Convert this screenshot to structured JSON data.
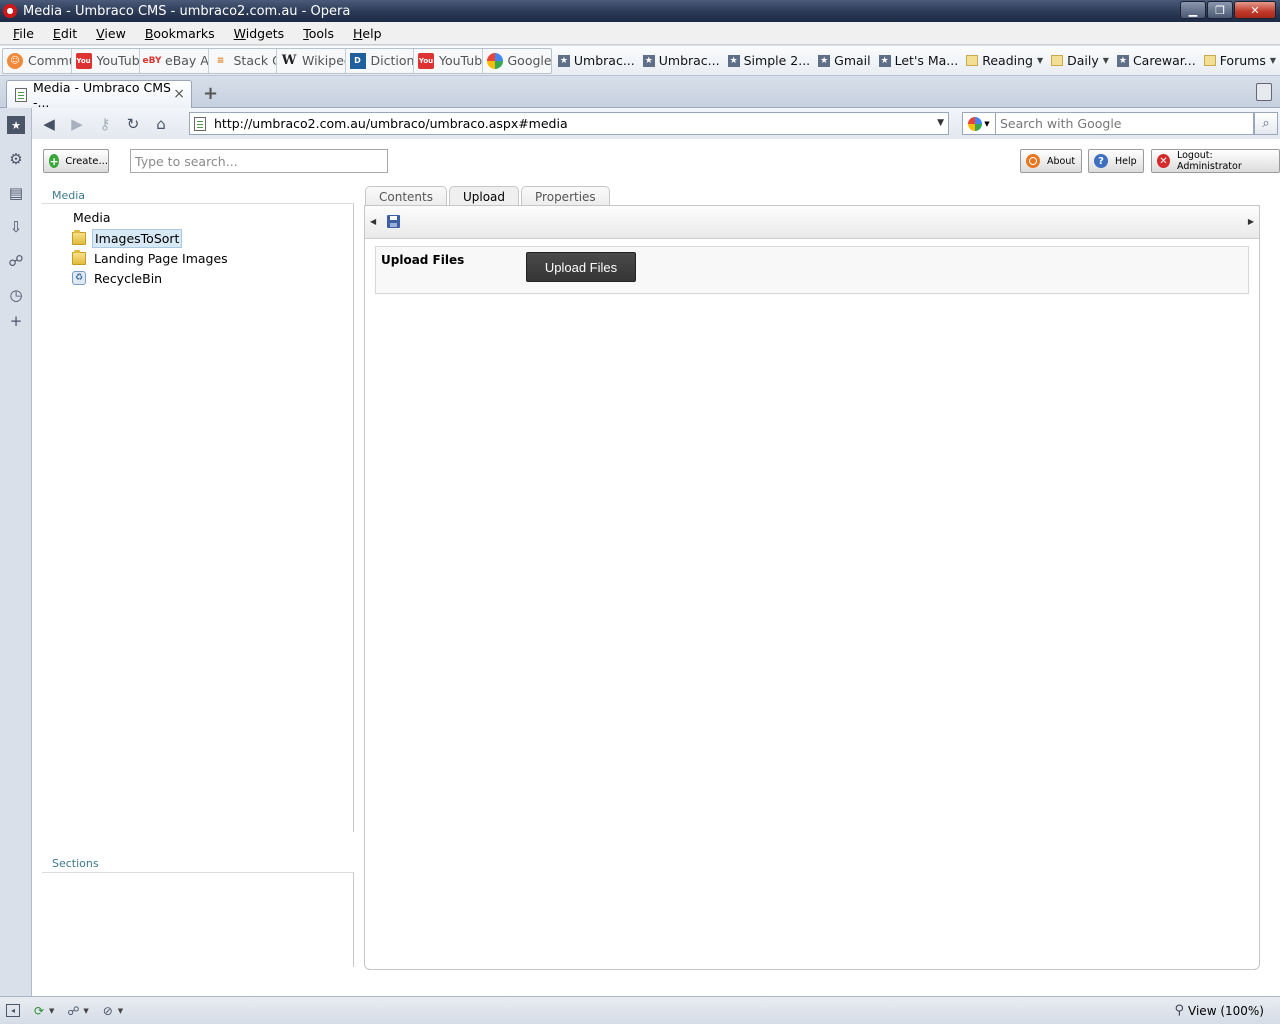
{
  "window": {
    "title": "Media - Umbraco CMS - umbraco2.com.au - Opera"
  },
  "menu": [
    {
      "label": "File",
      "ul": "F",
      "rest": "ile"
    },
    {
      "label": "Edit",
      "ul": "E",
      "rest": "dit"
    },
    {
      "label": "View",
      "ul": "V",
      "rest": "iew"
    },
    {
      "label": "Bookmarks",
      "ul": "B",
      "rest": "ookmarks"
    },
    {
      "label": "Widgets",
      "ul": "W",
      "rest": "idgets"
    },
    {
      "label": "Tools",
      "ul": "T",
      "rest": "ools"
    },
    {
      "label": "Help",
      "ul": "H",
      "rest": "elp"
    }
  ],
  "speed_dial": [
    {
      "label": "Commun",
      "icon": "community-icon"
    },
    {
      "label": "YouTube",
      "icon": "youtube-icon"
    },
    {
      "label": "eBay Aust",
      "icon": "ebay-icon"
    },
    {
      "label": "Stack Ove",
      "icon": "stackoverflow-icon"
    },
    {
      "label": "Wikipedia",
      "icon": "wikipedia-icon"
    },
    {
      "label": "Dictionary",
      "icon": "dictionary-icon"
    },
    {
      "label": "YouTube",
      "icon": "youtube-icon"
    },
    {
      "label": "Google",
      "icon": "google-icon"
    }
  ],
  "bookmarks": [
    {
      "label": "Umbrac...",
      "type": "star"
    },
    {
      "label": "Umbrac...",
      "type": "star"
    },
    {
      "label": "Simple 2...",
      "type": "star"
    },
    {
      "label": "Gmail",
      "type": "star"
    },
    {
      "label": "Let's Ma...",
      "type": "star"
    },
    {
      "label": "Reading",
      "type": "folder"
    },
    {
      "label": "Daily",
      "type": "folder"
    },
    {
      "label": "Carewar...",
      "type": "star"
    },
    {
      "label": "Forums",
      "type": "folder"
    }
  ],
  "tab": {
    "title": "Media - Umbraco CMS -...",
    "close": "×",
    "new_tab": "+"
  },
  "address": {
    "url": "http://umbraco2.com.au/umbraco/umbraco.aspx#media",
    "search_placeholder": "Search with Google"
  },
  "umbraco": {
    "create_label": "Create...",
    "search_placeholder": "Type to search...",
    "about_label": "About",
    "help_label": "Help",
    "logout_label": "Logout: Administrator",
    "tree_header": "Media",
    "tree_root": "Media",
    "tree_items": [
      {
        "label": "ImagesToSort",
        "icon": "folder-icon",
        "selected": true
      },
      {
        "label": "Landing Page Images",
        "icon": "folder-icon",
        "selected": false
      },
      {
        "label": "RecycleBin",
        "icon": "recycle-bin-icon",
        "selected": false
      }
    ],
    "sections_header": "Sections",
    "tabs": [
      {
        "label": "Contents",
        "active": false
      },
      {
        "label": "Upload",
        "active": true
      },
      {
        "label": "Properties",
        "active": false
      }
    ],
    "upload": {
      "field_label": "Upload Files",
      "button_label": "Upload Files"
    }
  },
  "status": {
    "zoom": "View (100%)"
  }
}
